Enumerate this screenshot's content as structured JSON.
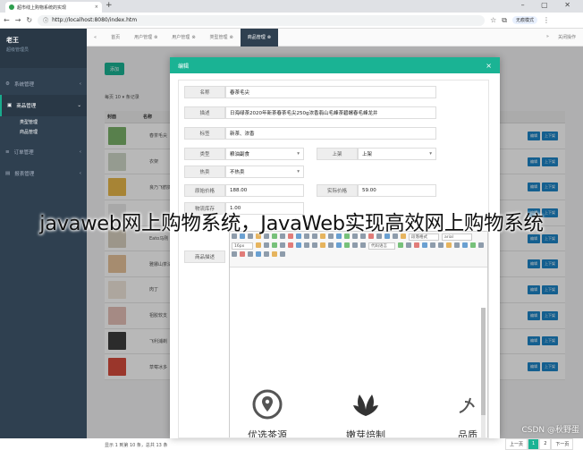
{
  "browser": {
    "tab_title": "超市线上购物系统的实现",
    "url": "http://localhost:8080/index.htm",
    "profile": "无痕模式",
    "win_controls": "–  ▢  ✕"
  },
  "sidebar": {
    "user_name": "老王",
    "user_role": "超级管理员",
    "items": [
      {
        "label": "系统管理"
      },
      {
        "label": "商品管理"
      },
      {
        "label": "订单管理"
      },
      {
        "label": "报表管理"
      }
    ],
    "sub_items": [
      {
        "label": "类型管理"
      },
      {
        "label": "商品管理"
      }
    ]
  },
  "topnav": {
    "tabs": [
      {
        "label": "首页"
      },
      {
        "label": "用户管理"
      },
      {
        "label": "用户管理"
      },
      {
        "label": "类型管理"
      },
      {
        "label": "商品管理"
      }
    ],
    "right": [
      "关闭操作"
    ]
  },
  "list": {
    "add_label": "添加",
    "show_label": "每页",
    "page_size": "10",
    "records_label": "条记录",
    "headers": [
      "封面",
      "名称"
    ],
    "rows": [
      {
        "name": "春茶毛尖"
      },
      {
        "name": "衣架"
      },
      {
        "name": "良乃飞鹤奶"
      },
      {
        "name": ""
      },
      {
        "name": "Eato马刚"
      },
      {
        "name": "雅娜山茶油"
      },
      {
        "name": "肉丁"
      },
      {
        "name": "祖胶软支"
      },
      {
        "name": "飞利浦剃"
      },
      {
        "name": "草莓冰多"
      }
    ],
    "action_edit": "编辑",
    "action_on": "上下架",
    "summary": "显示 1 到第 10 条，总共 13 条",
    "pager": [
      "上一页",
      "1",
      "2",
      "下一页"
    ]
  },
  "modal": {
    "title": "编辑",
    "close": "×",
    "fields": {
      "name_label": "名称",
      "name_value": "春茶毛尖",
      "desc_label": "描述",
      "desc_value": "日海绿茶2020年新茶春茶毛尖250g浓香翡山毛峰茶碧螺春毛峰龙井",
      "tag_label": "标签",
      "tag_value": "新茶、浓香",
      "type_label": "类型",
      "type_value": "粮油副食",
      "shelf_label": "上架",
      "shelf_value": "上架",
      "hot_label": "热卖",
      "hot_value": "不热卖",
      "orig_label": "原始价格",
      "orig_value": "188.00",
      "real_label": "实际价格",
      "real_value": "59.00",
      "stock_label": "物流库存",
      "stock_value": "1.00",
      "detail_label": "商品描述"
    },
    "editor": {
      "font_family": "arial",
      "font_size": "16px",
      "para": "段落格式",
      "code_lang": "代码语言"
    },
    "features": [
      {
        "label": "优选茶源",
        "icon": "location-pin-icon"
      },
      {
        "label": "嫩芽焙制",
        "icon": "tea-leaf-icon"
      },
      {
        "label": "品质",
        "icon": "quality-icon"
      }
    ]
  },
  "overlay_caption": "javaweb网上购物系统，JavaWeb实现高效网上购物系统",
  "watermark": "CSDN @秋野蛋",
  "colors": {
    "sidebar": "#2f4050",
    "accent": "#1ab394",
    "button_blue": "#1c84c6"
  }
}
